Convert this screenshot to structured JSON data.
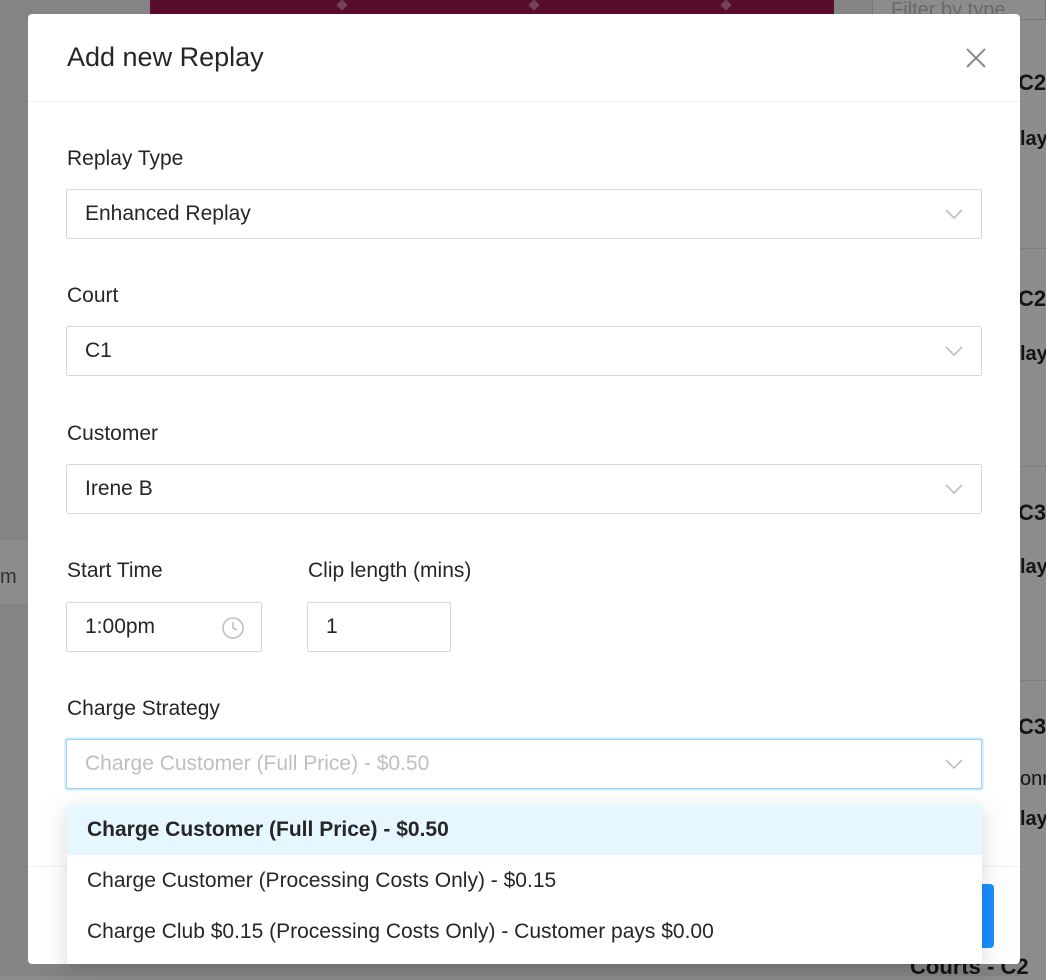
{
  "background": {
    "filter_placeholder": "Filter by type",
    "cards": [
      {
        "title": "C2",
        "sub": "lay"
      },
      {
        "title": "C2",
        "sub": "lay"
      },
      {
        "title": "C3",
        "sub": "lay"
      },
      {
        "title": "C3",
        "sub": "onn",
        "sub2": "lay"
      }
    ],
    "left_fragment": "m",
    "bottom_text": "Courts - C2"
  },
  "modal": {
    "title": "Add new Replay",
    "close_icon": "close-icon",
    "fields": {
      "replay_type": {
        "label": "Replay Type",
        "value": "Enhanced Replay"
      },
      "court": {
        "label": "Court",
        "value": "C1"
      },
      "customer": {
        "label": "Customer",
        "value": "Irene B"
      },
      "start_time": {
        "label": "Start Time",
        "value": "1:00pm"
      },
      "clip_length": {
        "label": "Clip length (mins)",
        "value": "1"
      },
      "charge_strategy": {
        "label": "Charge Strategy",
        "placeholder": "Charge Customer (Full Price) - $0.50"
      }
    },
    "dropdown": {
      "options": [
        {
          "label": "Charge Customer (Full Price) - $0.50",
          "selected": true
        },
        {
          "label": "Charge Customer (Processing Costs Only) - $0.15",
          "selected": false
        },
        {
          "label": "Charge Club $0.15 (Processing Costs Only) - Customer pays $0.00",
          "selected": false
        }
      ]
    }
  },
  "colors": {
    "accent": "#1890ff",
    "selected_option_bg": "#e6f7ff",
    "hero": "#a3154f"
  }
}
